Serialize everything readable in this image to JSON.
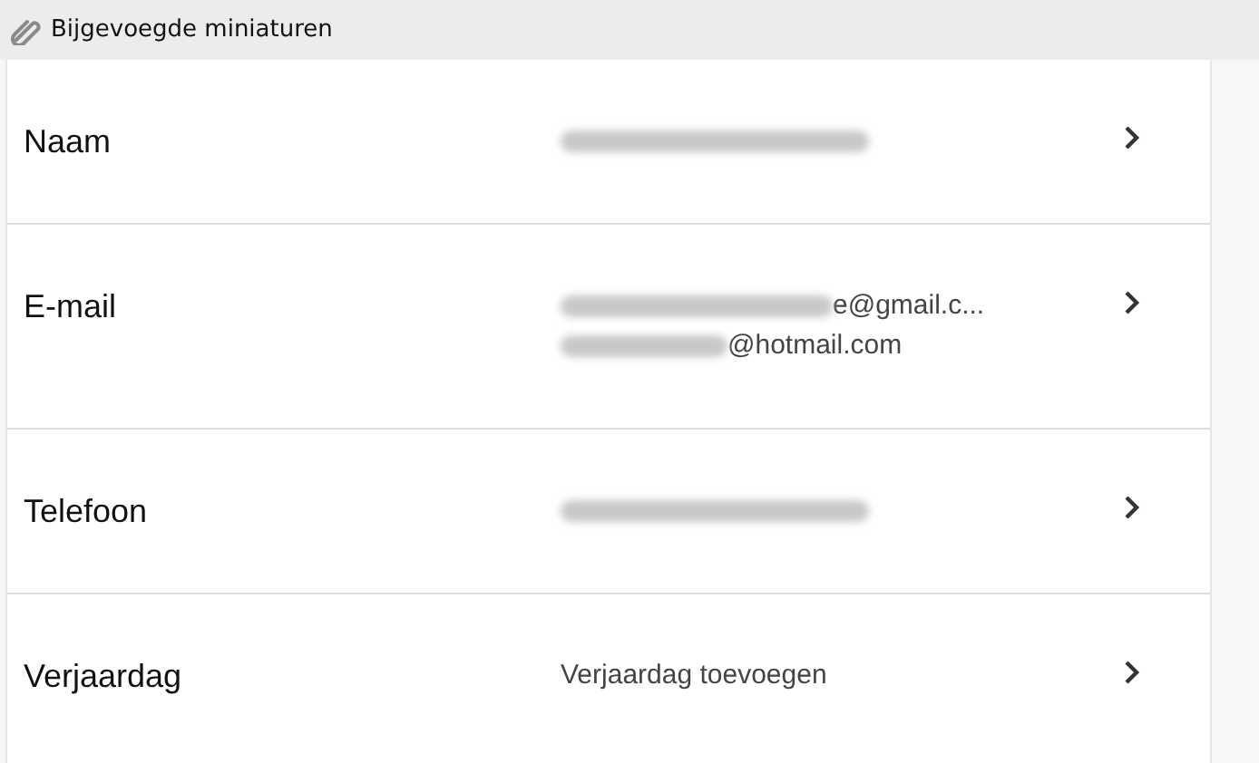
{
  "header": {
    "title": "Bijgevoegde miniaturen"
  },
  "rows": [
    {
      "label": "Naam",
      "values": [
        {
          "redacted": true
        }
      ]
    },
    {
      "label": "E-mail",
      "values": [
        {
          "redacted": true,
          "text": "e@gmail.c..."
        },
        {
          "redacted": true,
          "text": "@hotmail.com"
        }
      ]
    },
    {
      "label": "Telefoon",
      "values": [
        {
          "redacted": true
        }
      ]
    },
    {
      "label": "Verjaardag",
      "values": [
        {
          "redacted": false,
          "text": "Verjaardag toevoegen"
        }
      ]
    }
  ]
}
